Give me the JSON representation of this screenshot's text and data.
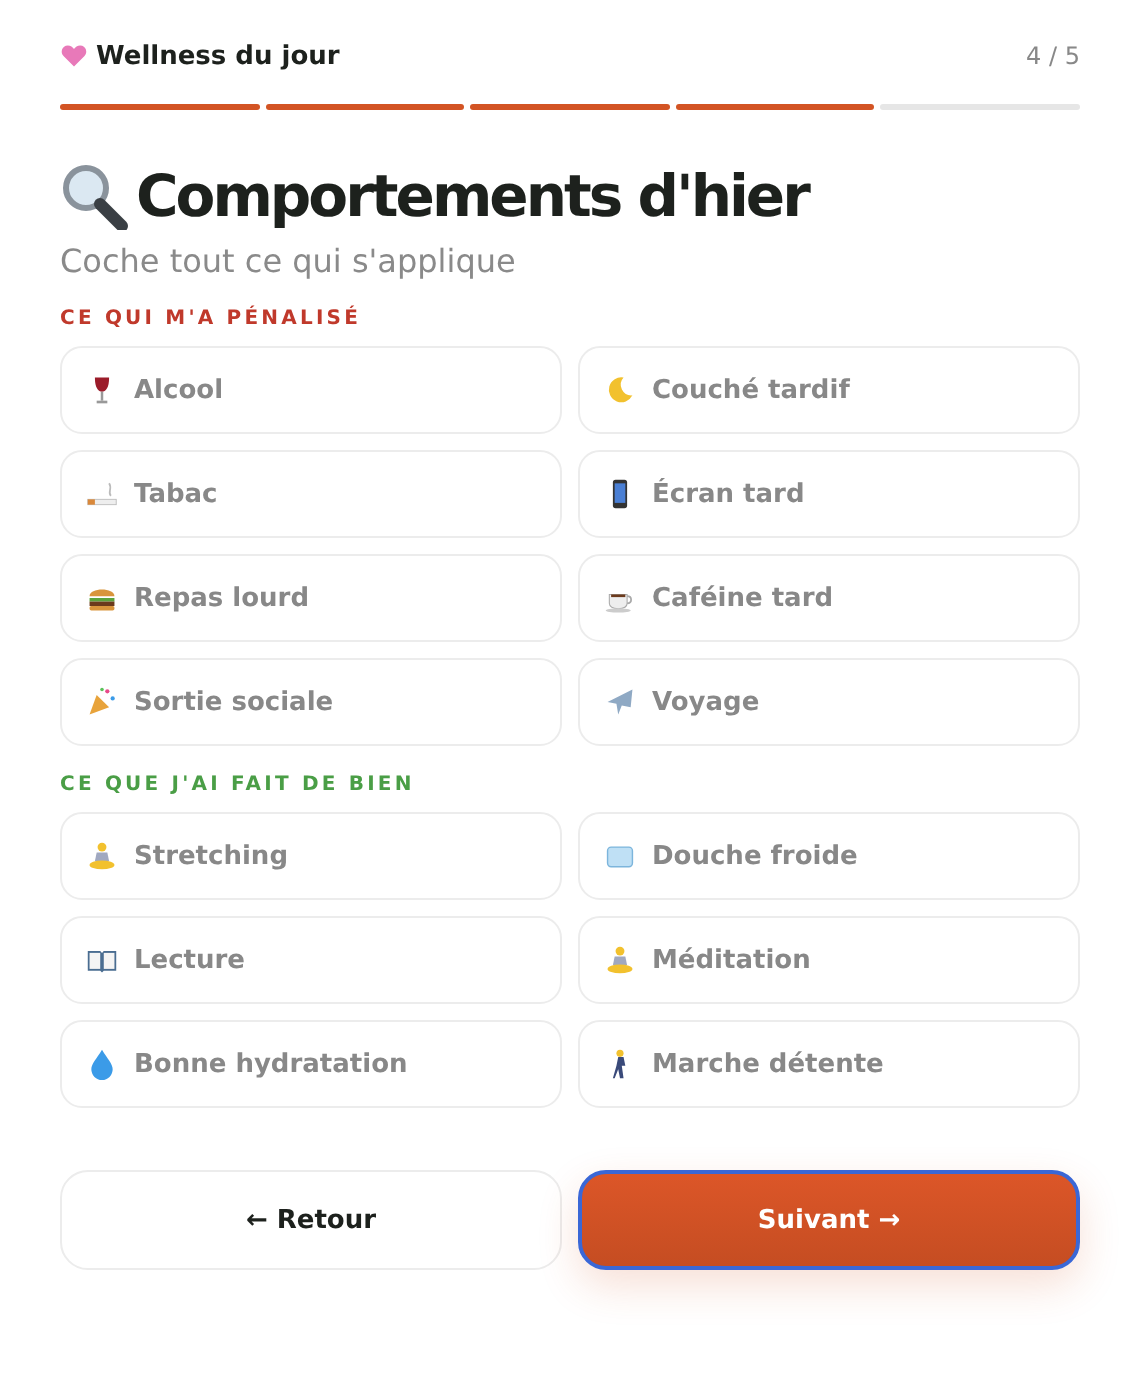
{
  "header": {
    "title": "Wellness du jour",
    "step": "4 / 5"
  },
  "progress": [
    {
      "done": true
    },
    {
      "done": true
    },
    {
      "done": true
    },
    {
      "done": true
    },
    {
      "done": false
    }
  ],
  "title": "Comportements d'hier",
  "subtitle": "Coche tout ce qui s'applique",
  "sections": [
    {
      "kind": "negative",
      "heading": "CE QUI M'A PÉNALISÉ",
      "items": [
        {
          "label": "Alcool",
          "checked": false
        },
        {
          "label": "Couché tardif",
          "checked": false
        },
        {
          "label": "Tabac",
          "checked": false
        },
        {
          "label": "Écran tard",
          "checked": false
        },
        {
          "label": "Repas lourd",
          "checked": false
        },
        {
          "label": "Caféine tard",
          "checked": false
        },
        {
          "label": "Sortie sociale",
          "checked": false
        },
        {
          "label": "Voyage",
          "checked": false
        }
      ]
    },
    {
      "kind": "positive",
      "heading": "CE QUE J'AI FAIT DE BIEN",
      "items": [
        {
          "label": "Stretching",
          "checked": false
        },
        {
          "label": "Douche froide",
          "checked": false
        },
        {
          "label": "Lecture",
          "checked": false
        },
        {
          "label": "Méditation",
          "checked": false
        },
        {
          "label": "Bonne hydratation",
          "checked": false
        },
        {
          "label": "Marche détente",
          "checked": false
        }
      ]
    }
  ],
  "buttons": [
    {
      "kind": "back",
      "label": "← Retour"
    },
    {
      "kind": "next",
      "label": "Suivant →"
    }
  ]
}
